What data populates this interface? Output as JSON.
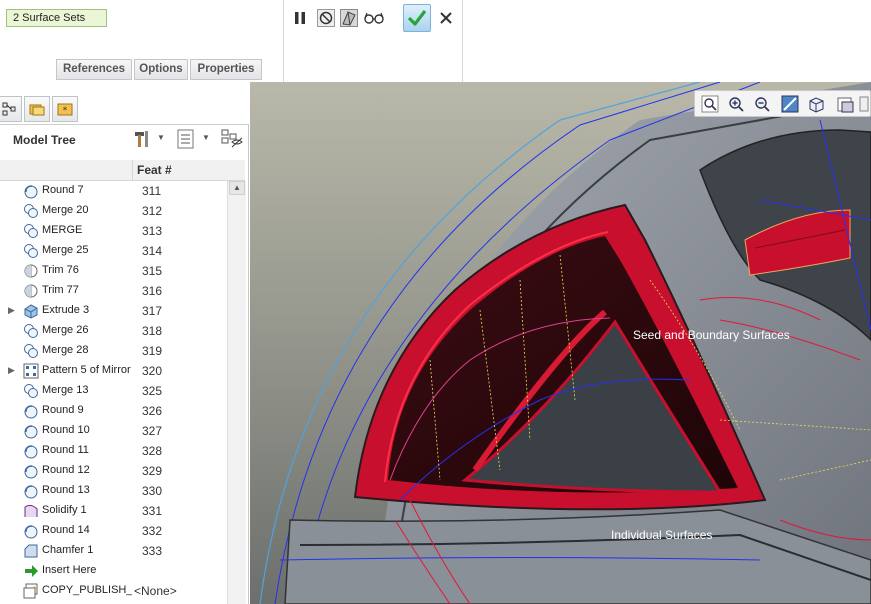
{
  "dashboard": {
    "surface_sets": "2 Surface Sets",
    "tabs": {
      "references": "References",
      "options": "Options",
      "properties": "Properties"
    },
    "icons": [
      "pause-icon",
      "no-preview-icon",
      "preview-icon",
      "glasses-icon",
      "checkmark-icon",
      "close-icon"
    ]
  },
  "panel": {
    "tree_title": "Model Tree",
    "column_feat": "Feat #",
    "rows": [
      {
        "name": "Round 7",
        "feat": "311",
        "icon": "round-icon",
        "expandable": false
      },
      {
        "name": "Merge 20",
        "feat": "312",
        "icon": "merge-icon",
        "expandable": false
      },
      {
        "name": "MERGE",
        "feat": "313",
        "icon": "merge-icon",
        "expandable": false
      },
      {
        "name": "Merge 25",
        "feat": "314",
        "icon": "merge-icon",
        "expandable": false
      },
      {
        "name": "Trim 76",
        "feat": "315",
        "icon": "trim-icon",
        "expandable": false
      },
      {
        "name": "Trim 77",
        "feat": "316",
        "icon": "trim-icon",
        "expandable": false
      },
      {
        "name": "Extrude 3",
        "feat": "317",
        "icon": "extrude-icon",
        "expandable": true
      },
      {
        "name": "Merge 26",
        "feat": "318",
        "icon": "merge-icon",
        "expandable": false
      },
      {
        "name": "Merge 28",
        "feat": "319",
        "icon": "merge-icon",
        "expandable": false
      },
      {
        "name": "Pattern 5 of Mirror",
        "feat": "320",
        "icon": "pattern-icon",
        "expandable": true
      },
      {
        "name": "Merge 13",
        "feat": "325",
        "icon": "merge-icon",
        "expandable": false
      },
      {
        "name": "Round 9",
        "feat": "326",
        "icon": "round-icon",
        "expandable": false
      },
      {
        "name": "Round 10",
        "feat": "327",
        "icon": "round-icon",
        "expandable": false
      },
      {
        "name": "Round 11",
        "feat": "328",
        "icon": "round-icon",
        "expandable": false
      },
      {
        "name": "Round 12",
        "feat": "329",
        "icon": "round-icon",
        "expandable": false
      },
      {
        "name": "Round 13",
        "feat": "330",
        "icon": "round-icon",
        "expandable": false
      },
      {
        "name": "Solidify 1",
        "feat": "331",
        "icon": "solidify-icon",
        "expandable": false
      },
      {
        "name": "Round 14",
        "feat": "332",
        "icon": "round-icon",
        "expandable": false
      },
      {
        "name": "Chamfer 1",
        "feat": "333",
        "icon": "chamfer-icon",
        "expandable": false
      },
      {
        "name": "Insert Here",
        "feat": "",
        "icon": "insert-arrow-icon",
        "expandable": false
      },
      {
        "name": "COPY_PUBLISH_",
        "feat": "<None>",
        "icon": "copy-publish-icon",
        "expandable": false
      }
    ]
  },
  "viewport": {
    "label_seed": "Seed and Boundary Surfaces",
    "label_individual": "Individual Surfaces"
  },
  "colors": {
    "accent_green": "#8cc63f",
    "surface_highlight": "#c8102e",
    "edge_blue": "#2233ee",
    "model_gray": "#8e949c"
  }
}
